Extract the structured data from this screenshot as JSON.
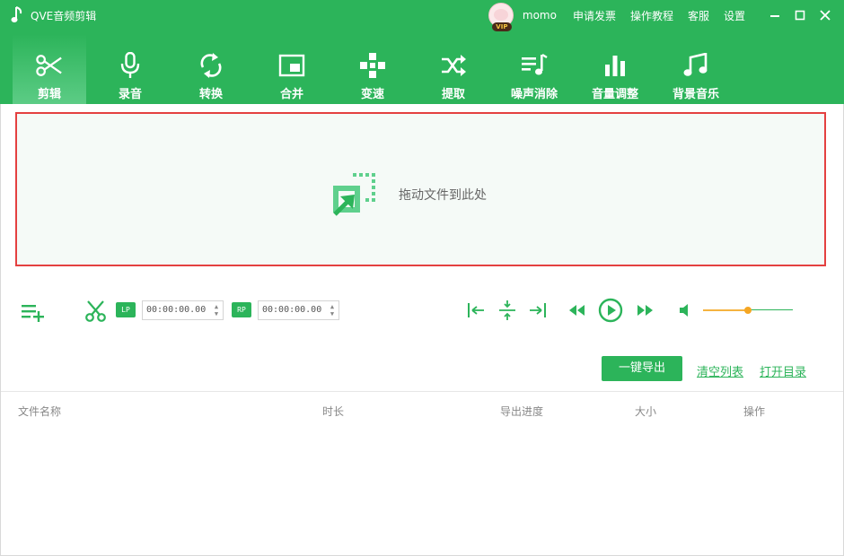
{
  "app": {
    "title": "QVE音频剪辑"
  },
  "user": {
    "name": "momo",
    "vip_badge": "VIP"
  },
  "top_links": [
    "申请发票",
    "操作教程",
    "客服",
    "设置"
  ],
  "colors": {
    "brand": "#2cb45a",
    "drop_border": "#e44040",
    "volume_fill": "#f5a623"
  },
  "nav": {
    "active": 0,
    "items": [
      {
        "label": "剪辑",
        "icon": "scissors-icon"
      },
      {
        "label": "录音",
        "icon": "microphone-icon"
      },
      {
        "label": "转换",
        "icon": "convert-icon"
      },
      {
        "label": "合并",
        "icon": "merge-icon"
      },
      {
        "label": "变速",
        "icon": "speed-icon"
      },
      {
        "label": "提取",
        "icon": "extract-icon"
      },
      {
        "label": "噪声消除",
        "icon": "noise-removal-icon"
      },
      {
        "label": "音量调整",
        "icon": "volume-adjust-icon"
      },
      {
        "label": "背景音乐",
        "icon": "music-note-icon"
      }
    ]
  },
  "dropzone": {
    "text": "拖动文件到此处"
  },
  "controls": {
    "lp_tag": "LP",
    "rp_tag": "RP",
    "start_time": "00:00:00.00",
    "end_time": "00:00:00.00",
    "volume": 0.5
  },
  "actions": {
    "export_all": "一键导出",
    "clear_list": "清空列表",
    "open_dir": "打开目录"
  },
  "table": {
    "columns": [
      "文件名称",
      "时长",
      "导出进度",
      "大小",
      "操作"
    ]
  }
}
